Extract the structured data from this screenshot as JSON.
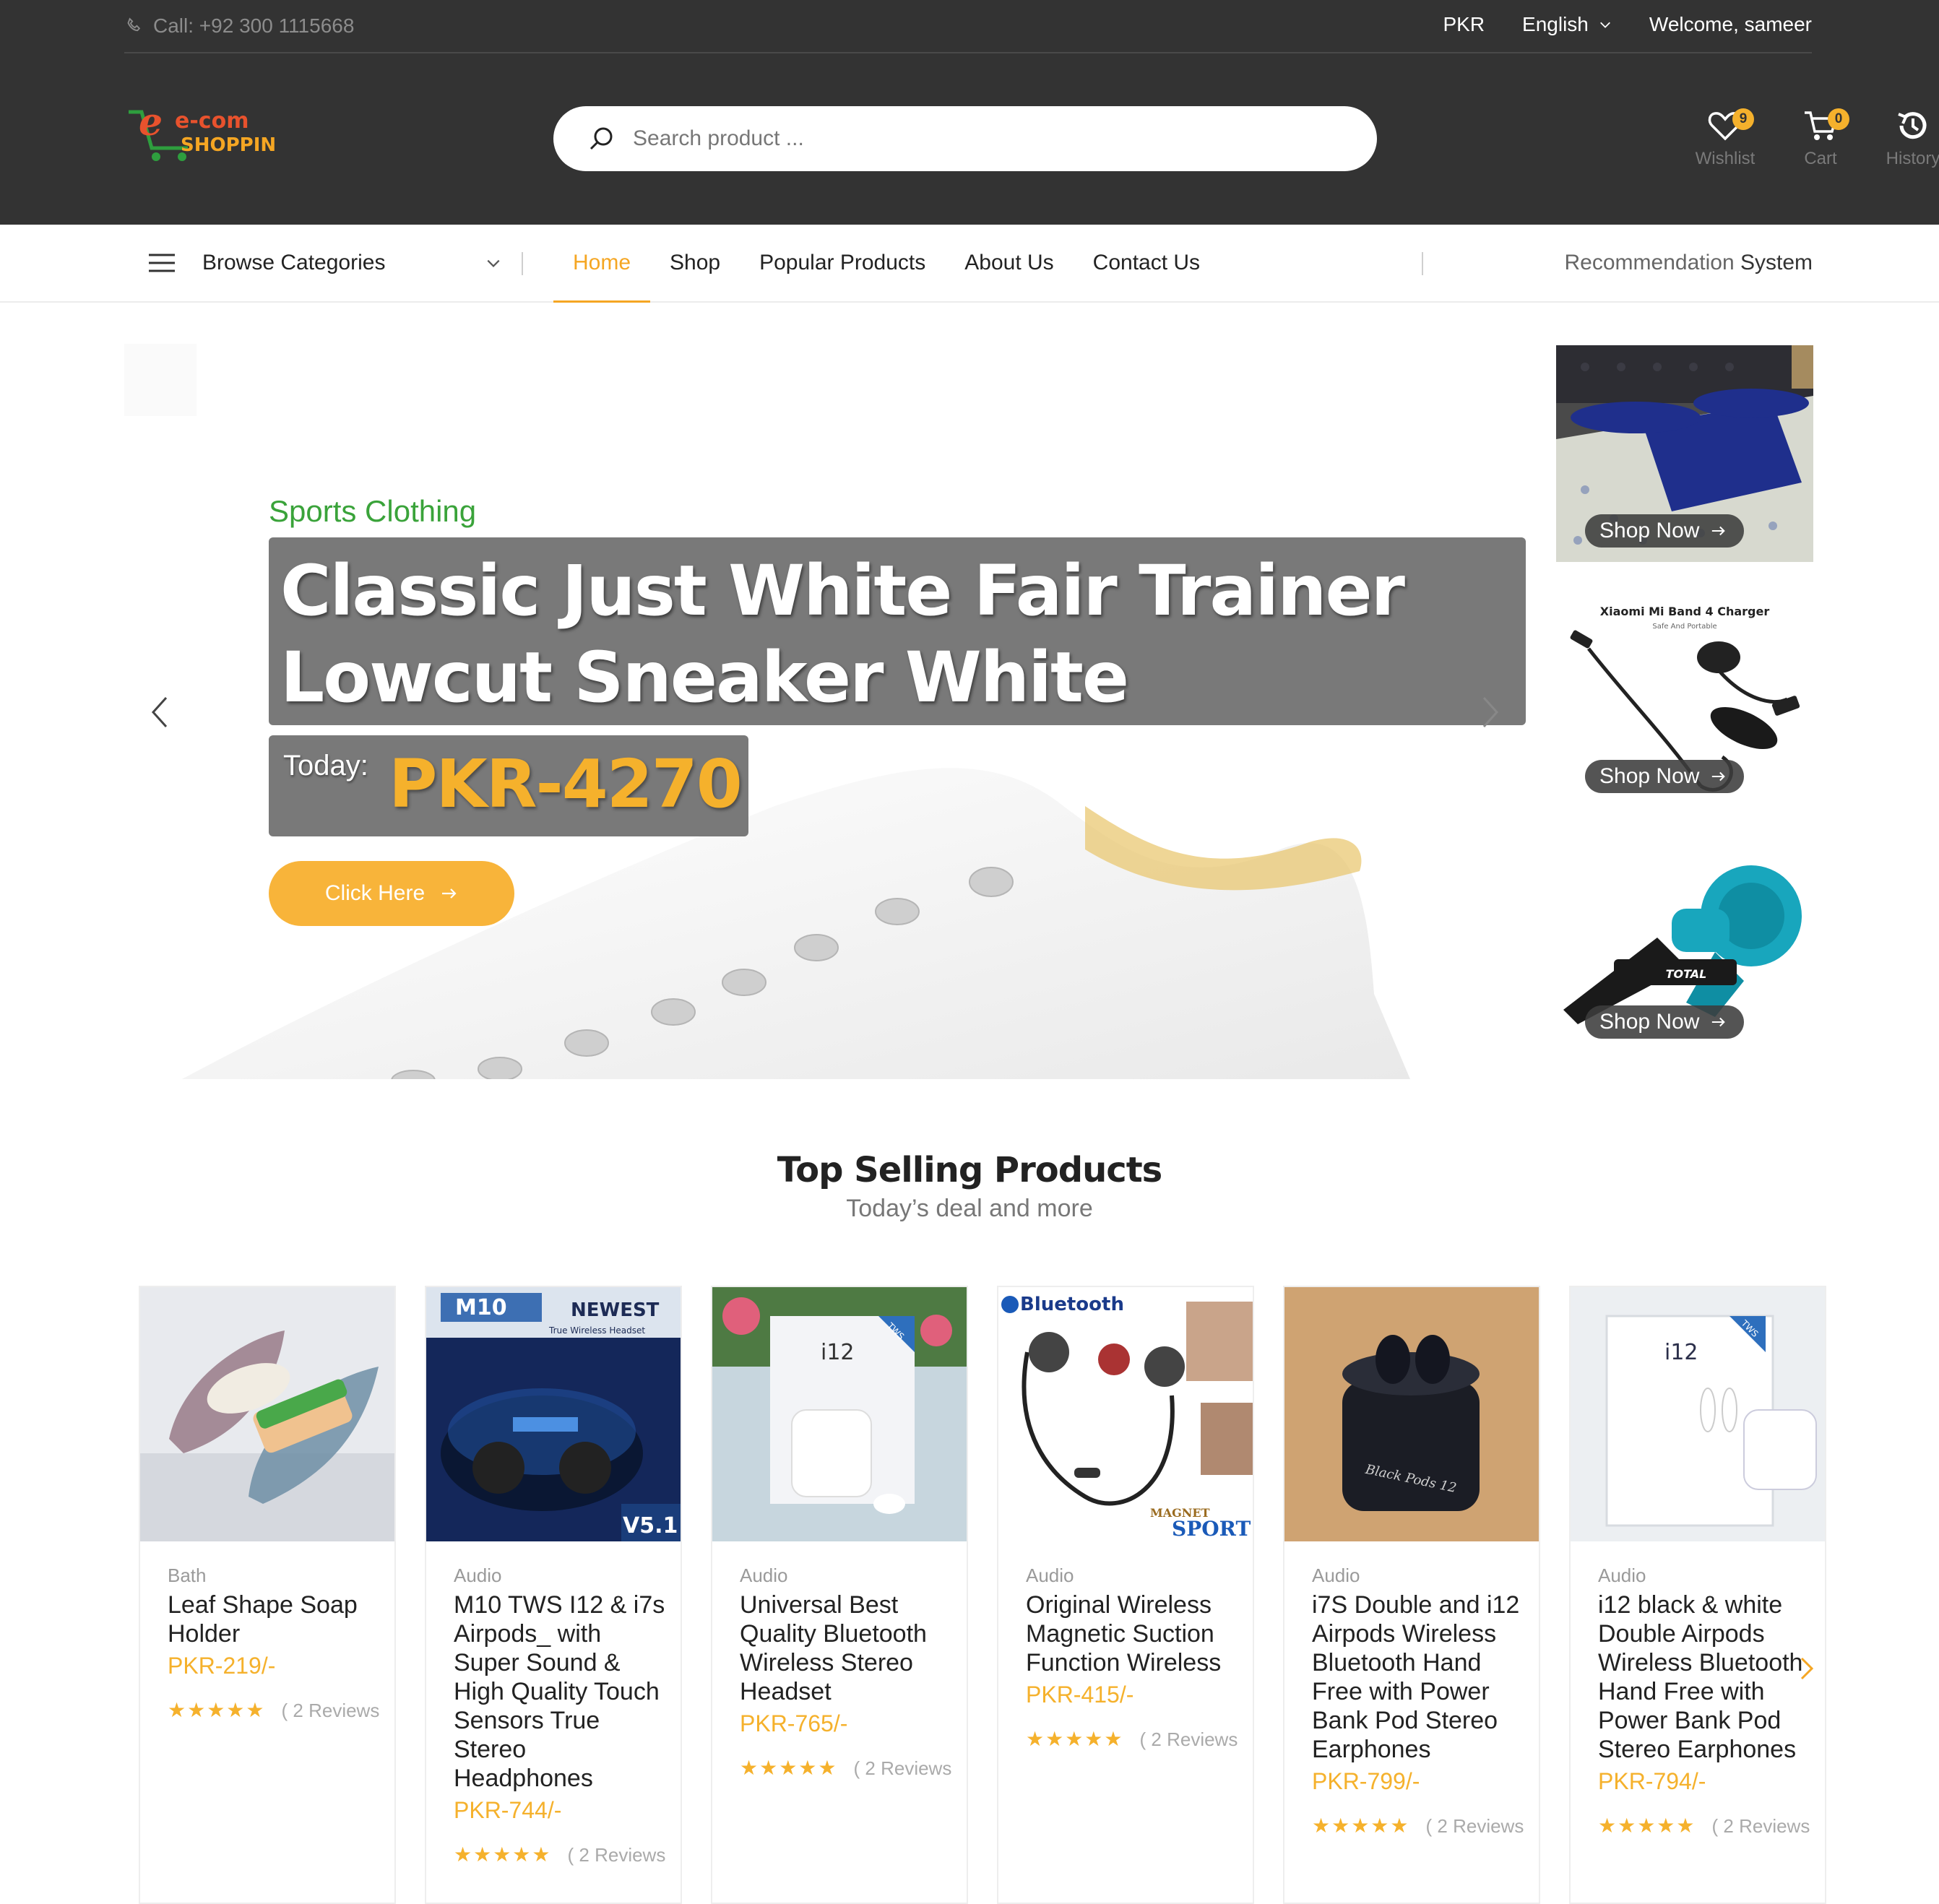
{
  "topbar": {
    "call": "Call: +92 300 1115668",
    "currency": "PKR",
    "language": "English",
    "welcome": "Welcome, sameer"
  },
  "logo": {
    "line1": "e-com",
    "line2": "SHOPPING"
  },
  "search": {
    "placeholder": "Search product ..."
  },
  "header_icons": {
    "wishlist": {
      "label": "Wishlist",
      "count": "9"
    },
    "cart": {
      "label": "Cart",
      "count": "0"
    },
    "history": {
      "label": "History"
    }
  },
  "nav": {
    "browse": "Browse Categories",
    "items": [
      "Home",
      "Shop",
      "Popular Products",
      "About Us",
      "Contact Us"
    ],
    "active": "Home",
    "recommendation_a": "Recommendation",
    "recommendation_b": "System"
  },
  "hero": {
    "tag": "Sports Clothing",
    "title": "Classic Just White Fair Trainer Lowcut Sneaker White",
    "today": "Today:",
    "price": "PKR-4270",
    "cta": "Click Here"
  },
  "side_banners": {
    "shop_now": "Shop Now",
    "charger_title": "Xiaomi Mi Band 4 Charger",
    "charger_sub": "Safe And Portable",
    "blower_brand": "TOTAL"
  },
  "section": {
    "title": "Top Selling Products",
    "subtitle": "Today’s deal and more"
  },
  "products": [
    {
      "category": "Bath",
      "name": "Leaf Shape Soap Holder",
      "price": "PKR-219/-",
      "stars": "★★★★★",
      "reviews": "( 2 Reviews"
    },
    {
      "category": "Audio",
      "name": "M10 TWS I12 & i7s Airpods_ with Super Sound & High Quality Touch Sensors True Stereo Headphones",
      "price": "PKR-744/-",
      "stars": "★★★★★",
      "reviews": "( 2 Reviews",
      "img_text_a": "M10",
      "img_text_b": "NEWEST",
      "img_text_c": "True Wireless Headset",
      "img_text_d": "V5.1"
    },
    {
      "category": "Audio",
      "name": "Universal Best Quality Bluetooth Wireless Stereo Headset",
      "price": "PKR-765/-",
      "stars": "★★★★★",
      "reviews": "( 2 Reviews",
      "img_text_a": "i12",
      "img_text_b": "TWS"
    },
    {
      "category": "Audio",
      "name": "Original Wireless Magnetic Suction Function Wireless",
      "price": "PKR-415/-",
      "stars": "★★★★★",
      "reviews": "( 2 Reviews",
      "img_text_a": "Bluetooth",
      "img_text_b": "MAGNET",
      "img_text_c": "SPORT"
    },
    {
      "category": "Audio",
      "name": "i7S Double and i12 Airpods Wireless Bluetooth Hand Free with Power Bank Pod Stereo Earphones",
      "price": "PKR-799/-",
      "stars": "★★★★★",
      "reviews": "( 2 Reviews",
      "img_text_a": "Black Pods 12"
    },
    {
      "category": "Audio",
      "name": "i12 black & white Double Airpods Wireless Bluetooth Hand Free with Power Bank Pod Stereo Earphones",
      "price": "PKR-794/-",
      "stars": "★★★★★",
      "reviews": "( 2 Reviews",
      "img_text_a": "i12",
      "img_text_b": "TWS"
    }
  ],
  "colors": {
    "accent": "#f5b12c",
    "header_bg": "#333333",
    "green": "#3aa33a"
  }
}
